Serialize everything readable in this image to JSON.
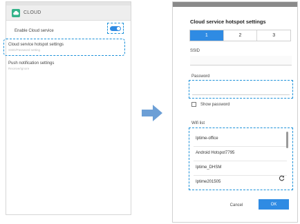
{
  "left": {
    "app_title": "CLOUD",
    "enable_label": "Enable Cloud service",
    "hotspot": {
      "label": "Cloud service hotspot settings",
      "sub": "SSID/Password setting"
    },
    "push": {
      "label": "Push notification settings",
      "sub": "Receive/Ignore"
    }
  },
  "right": {
    "title": "Cloud service hotspot settings",
    "tabs": [
      "1",
      "2",
      "3"
    ],
    "ssid_label": "SSID",
    "password_label": "Password",
    "show_password_label": "Show password",
    "wifi_label": "Wifi list",
    "wifi_items": [
      "Iptime-office",
      "Android Hotspot7795",
      "Iptime_DHSM",
      "Iptime201505"
    ],
    "cancel_label": "Cancel",
    "ok_label": "OK"
  },
  "colors": {
    "accent": "#2f8be3",
    "highlight": "#1a90d9",
    "app_icon": "#34b38a",
    "arrow": "#6c9fd6"
  }
}
